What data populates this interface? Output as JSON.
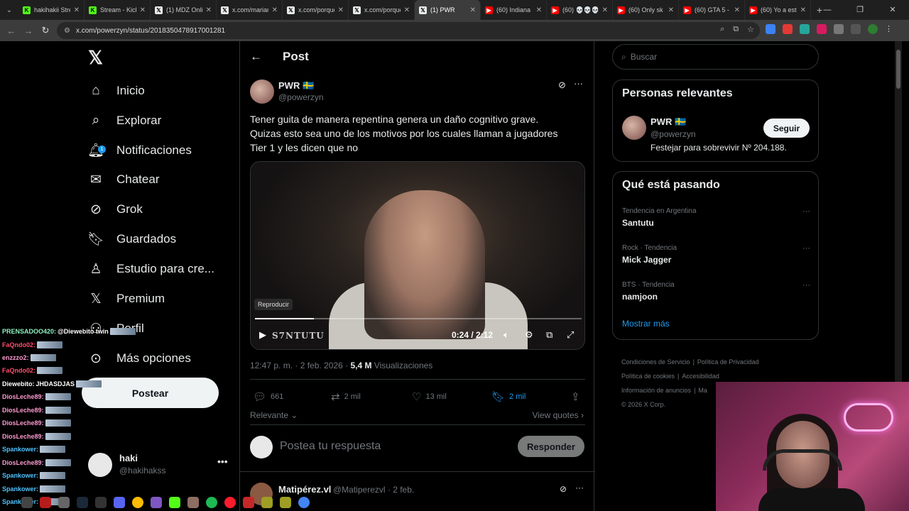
{
  "browser": {
    "tabs": [
      {
        "title": "hakihakii Stream",
        "color": "#53fc18",
        "fav": "K"
      },
      {
        "title": "Stream - Kick",
        "color": "#53fc18",
        "fav": "K"
      },
      {
        "title": "(1) MDZ Online",
        "color": "#e7e9ea",
        "fav": "𝕏"
      },
      {
        "title": "x.com/mariano",
        "color": "#e7e9ea",
        "fav": "𝕏"
      },
      {
        "title": "x.com/porque",
        "color": "#e7e9ea",
        "fav": "𝕏"
      },
      {
        "title": "x.com/porque",
        "color": "#e7e9ea",
        "fav": "𝕏"
      },
      {
        "title": "(1) PWR",
        "color": "#e7e9ea",
        "fav": "𝕏"
      },
      {
        "title": "(60) Indiana",
        "color": "#ff0000",
        "fav": "▶"
      },
      {
        "title": "(60) 💀💀💀",
        "color": "#ff0000",
        "fav": "▶"
      },
      {
        "title": "(60) Only sk",
        "color": "#ff0000",
        "fav": "▶"
      },
      {
        "title": "(60) GTA 5 -",
        "color": "#ff0000",
        "fav": "▶"
      },
      {
        "title": "(60) Yo a esto",
        "color": "#ff0000",
        "fav": "▶"
      }
    ],
    "url": "x.com/powerzyn/status/2018350478917001281"
  },
  "nav": {
    "items": [
      {
        "label": "Inicio",
        "icon": "home-icon"
      },
      {
        "label": "Explorar",
        "icon": "search-icon"
      },
      {
        "label": "Notificaciones",
        "icon": "bell-icon",
        "badge": "1"
      },
      {
        "label": "Chatear",
        "icon": "mail-icon"
      },
      {
        "label": "Grok",
        "icon": "grok-icon"
      },
      {
        "label": "Guardados",
        "icon": "bookmark-icon"
      },
      {
        "label": "Estudio para cre...",
        "icon": "studio-icon"
      },
      {
        "label": "Premium",
        "icon": "x-icon"
      },
      {
        "label": "Perfil",
        "icon": "person-icon"
      },
      {
        "label": "Más opciones",
        "icon": "more-circle-icon"
      }
    ],
    "post_button": "Postear",
    "account": {
      "name": "haki",
      "handle": "@hakihakss"
    }
  },
  "stream_chat": [
    {
      "user": "PRENSADOO420:",
      "color": "#8ef0c0",
      "msg": "@Diewebito twin"
    },
    {
      "user": "FaQndo02:",
      "color": "#ff4d6d",
      "msg": ""
    },
    {
      "user": "enzzzo2:",
      "color": "#ff9ad1",
      "msg": ""
    },
    {
      "user": "FaQndo02:",
      "color": "#ff4d6d",
      "msg": ""
    },
    {
      "user": "Diewebito:",
      "color": "#ffffff",
      "msg": "JHDASDJAS"
    },
    {
      "user": "DiosLeche89:",
      "color": "#ff9ad1",
      "msg": ""
    },
    {
      "user": "DiosLeche89:",
      "color": "#ff9ad1",
      "msg": ""
    },
    {
      "user": "DiosLeche89:",
      "color": "#ff9ad1",
      "msg": ""
    },
    {
      "user": "DiosLeche89:",
      "color": "#ff9ad1",
      "msg": ""
    },
    {
      "user": "Spankower:",
      "color": "#4fc3ff",
      "msg": ""
    },
    {
      "user": "DiosLeche89:",
      "color": "#ff9ad1",
      "msg": ""
    },
    {
      "user": "Spankower:",
      "color": "#4fc3ff",
      "msg": ""
    },
    {
      "user": "Spankower:",
      "color": "#4fc3ff",
      "msg": ""
    },
    {
      "user": "Spankower:",
      "color": "#4fc3ff",
      "msg": ""
    }
  ],
  "post": {
    "header": "Post",
    "author": {
      "name": "PWR 🇸🇪",
      "handle": "@powerzyn"
    },
    "text_lines": [
      "Tener guita de manera repentina genera un daño cognitivo grave.",
      "Quizas esto sea uno de los motivos por los cuales llaman a jugadores",
      "Tier 1 y les dicen que no"
    ],
    "video": {
      "tooltip": "Reproducir",
      "time": "0:24 / 2:12",
      "progress": 0.18,
      "brand": "S7NTUTU"
    },
    "time": "12:47 p. m. · 2 feb. 2026 ·",
    "views": "5,4 M",
    "views_label": "Visualizaciones",
    "replies": "661",
    "reposts": "2 mil",
    "likes": "13 mil",
    "bookmarks": "2 mil",
    "sort_label": "Relevante",
    "view_quotes": "View quotes",
    "reply_placeholder": "Postea tu respuesta",
    "reply_button": "Responder",
    "next_reply": {
      "name": "Matipérez.vl",
      "handle": "@Matiperezvl · 2 feb."
    }
  },
  "right": {
    "search_placeholder": "Buscar",
    "relevant_title": "Personas relevantes",
    "relevant": {
      "name": "PWR 🇸🇪",
      "handle": "@powerzyn",
      "bio": "Festejar para sobrevivir Nº 204.188.",
      "follow": "Seguir"
    },
    "trending_title": "Qué está pasando",
    "trends": [
      {
        "context": "Tendencia en Argentina",
        "name": "Santutu"
      },
      {
        "context": "Rock · Tendencia",
        "name": "Mick Jagger"
      },
      {
        "context": "BTS · Tendencia",
        "name": "namjoon"
      }
    ],
    "show_more": "Mostrar más",
    "footer": [
      "Condiciones de Servicio",
      "Política de Privacidad",
      "Política de cookies",
      "Accesibilidad",
      "Información de anuncios",
      "Ma",
      "© 2026 X Corp."
    ]
  },
  "colors": {
    "accent": "#1d9bf0",
    "background": "#000000",
    "border": "#2f3336"
  }
}
